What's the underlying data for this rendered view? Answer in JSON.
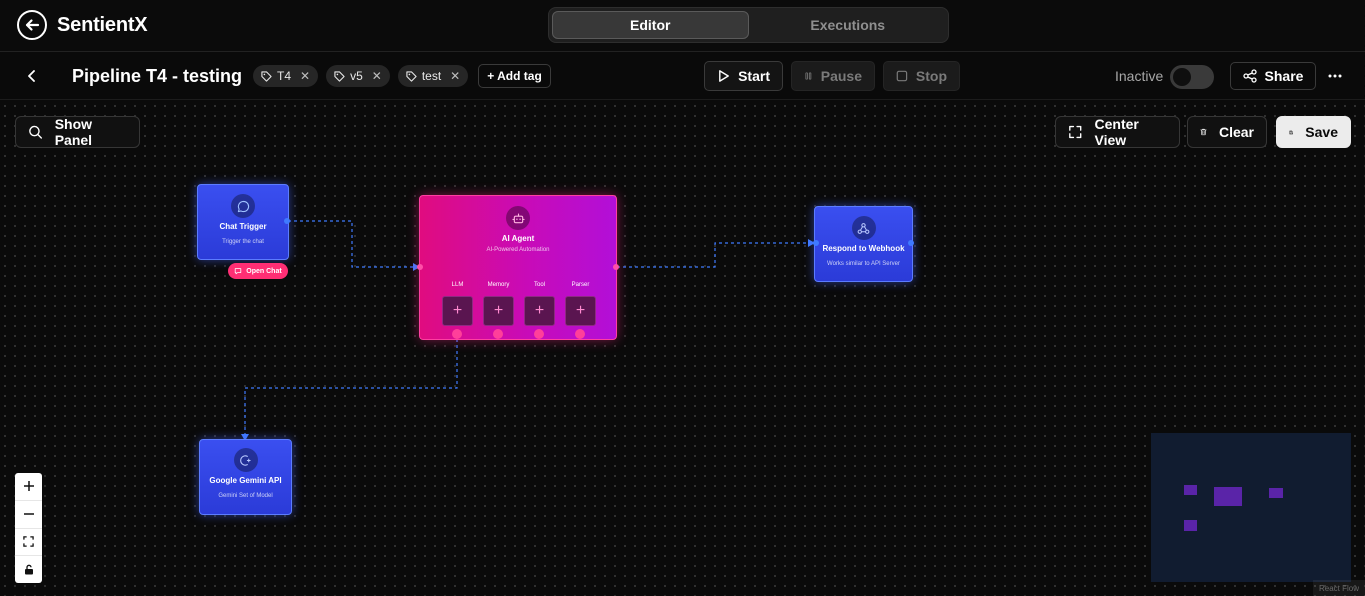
{
  "app": {
    "name": "SentientX"
  },
  "view_tabs": [
    {
      "label": "Editor",
      "active": true
    },
    {
      "label": "Executions",
      "active": false
    }
  ],
  "pipeline": {
    "title": "Pipeline T4 - testing",
    "tags": [
      "T4",
      "v5",
      "test"
    ],
    "add_tag_label": "+ Add tag"
  },
  "run_controls": {
    "start": "Start",
    "pause": "Pause",
    "stop": "Stop"
  },
  "status": {
    "label": "Inactive",
    "active": false
  },
  "share_label": "Share",
  "canvas_controls": {
    "show_panel": "Show Panel",
    "center_view": "Center View",
    "clear": "Clear",
    "save": "Save"
  },
  "nodes": {
    "chat_trigger": {
      "title": "Chat Trigger",
      "subtitle": "Trigger the chat",
      "action": "Open Chat"
    },
    "ai_agent": {
      "title": "AI Agent",
      "subtitle": "AI-Powered Automation",
      "slots": [
        "LLM",
        "Memory",
        "Tool",
        "Parser"
      ]
    },
    "webhook": {
      "title": "Respond to Webhook",
      "subtitle": "Works similar to API Server"
    },
    "gemini": {
      "title": "Google Gemini API",
      "subtitle": "Gemini Set of Model"
    }
  },
  "attribution": "React Flow",
  "colors": {
    "agent_node": "#e00c7f",
    "blue_node": "#3a4ff0",
    "edge": "#3f7aff",
    "open_chat": "#ff2e74",
    "minimap_bg": "#111c30",
    "minimap_node": "#5a24a8"
  }
}
